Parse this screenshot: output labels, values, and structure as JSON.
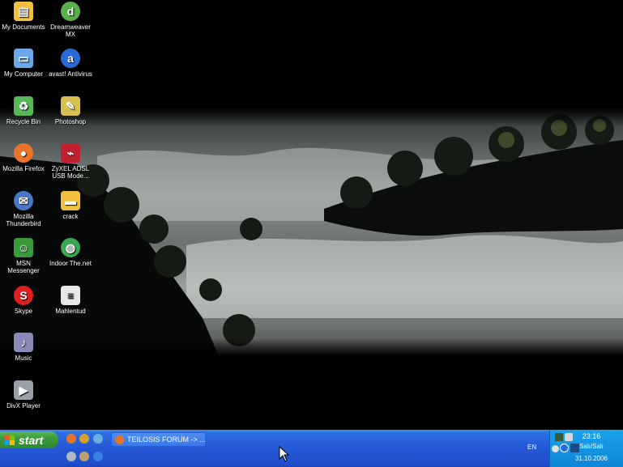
{
  "desktop": {
    "icons_col1": [
      {
        "label": "My Documents",
        "icon": "folder-documents-icon",
        "color": "#f0c040"
      },
      {
        "label": "My Computer",
        "icon": "computer-icon",
        "color": "#6aa8e8"
      },
      {
        "label": "Recycle Bin",
        "icon": "recycle-bin-icon",
        "color": "#58b858"
      },
      {
        "label": "Mozilla Firefox",
        "icon": "firefox-icon",
        "color": "#e8742a"
      },
      {
        "label": "Mozilla Thunderbird",
        "icon": "thunderbird-icon",
        "color": "#4a78c8"
      },
      {
        "label": "MSN Messenger",
        "icon": "msn-messenger-icon",
        "color": "#3a9a3a"
      },
      {
        "label": "Skype",
        "icon": "skype-icon",
        "color": "#e02020"
      },
      {
        "label": "Music",
        "icon": "music-icon",
        "color": "#8a8ab8"
      },
      {
        "label": "DivX Player",
        "icon": "divx-player-icon",
        "color": "#9aa0a8"
      }
    ],
    "icons_col2": [
      {
        "label": "Dreamweaver MX",
        "icon": "dreamweaver-icon",
        "color": "#5ab04a"
      },
      {
        "label": "avast! Antivirus",
        "icon": "avast-icon",
        "color": "#2a6ad8"
      },
      {
        "label": "Photoshop",
        "icon": "photoshop-icon",
        "color": "#d8c050"
      },
      {
        "label": "ZyXEL ADSL USB Mode...",
        "icon": "modem-icon",
        "color": "#c02030"
      },
      {
        "label": "crack",
        "icon": "folder-icon",
        "color": "#f0c040"
      },
      {
        "label": "Indoor The.net",
        "icon": "globe-icon",
        "color": "#3aa850"
      },
      {
        "label": "Mahlentud",
        "icon": "notepad-icon",
        "color": "#e8e8e8"
      }
    ]
  },
  "taskbar": {
    "start_label": "start",
    "task_item_label": "TEILOSIS FORUM -> ...",
    "language": "EN",
    "clock_time": "23:16",
    "clock_day": "Salı/Salı",
    "clock_date": "31.10.2006"
  },
  "colors": {
    "taskbar": "#2457d6",
    "start": "#3c9a3c",
    "tray": "#1aa2ec"
  }
}
